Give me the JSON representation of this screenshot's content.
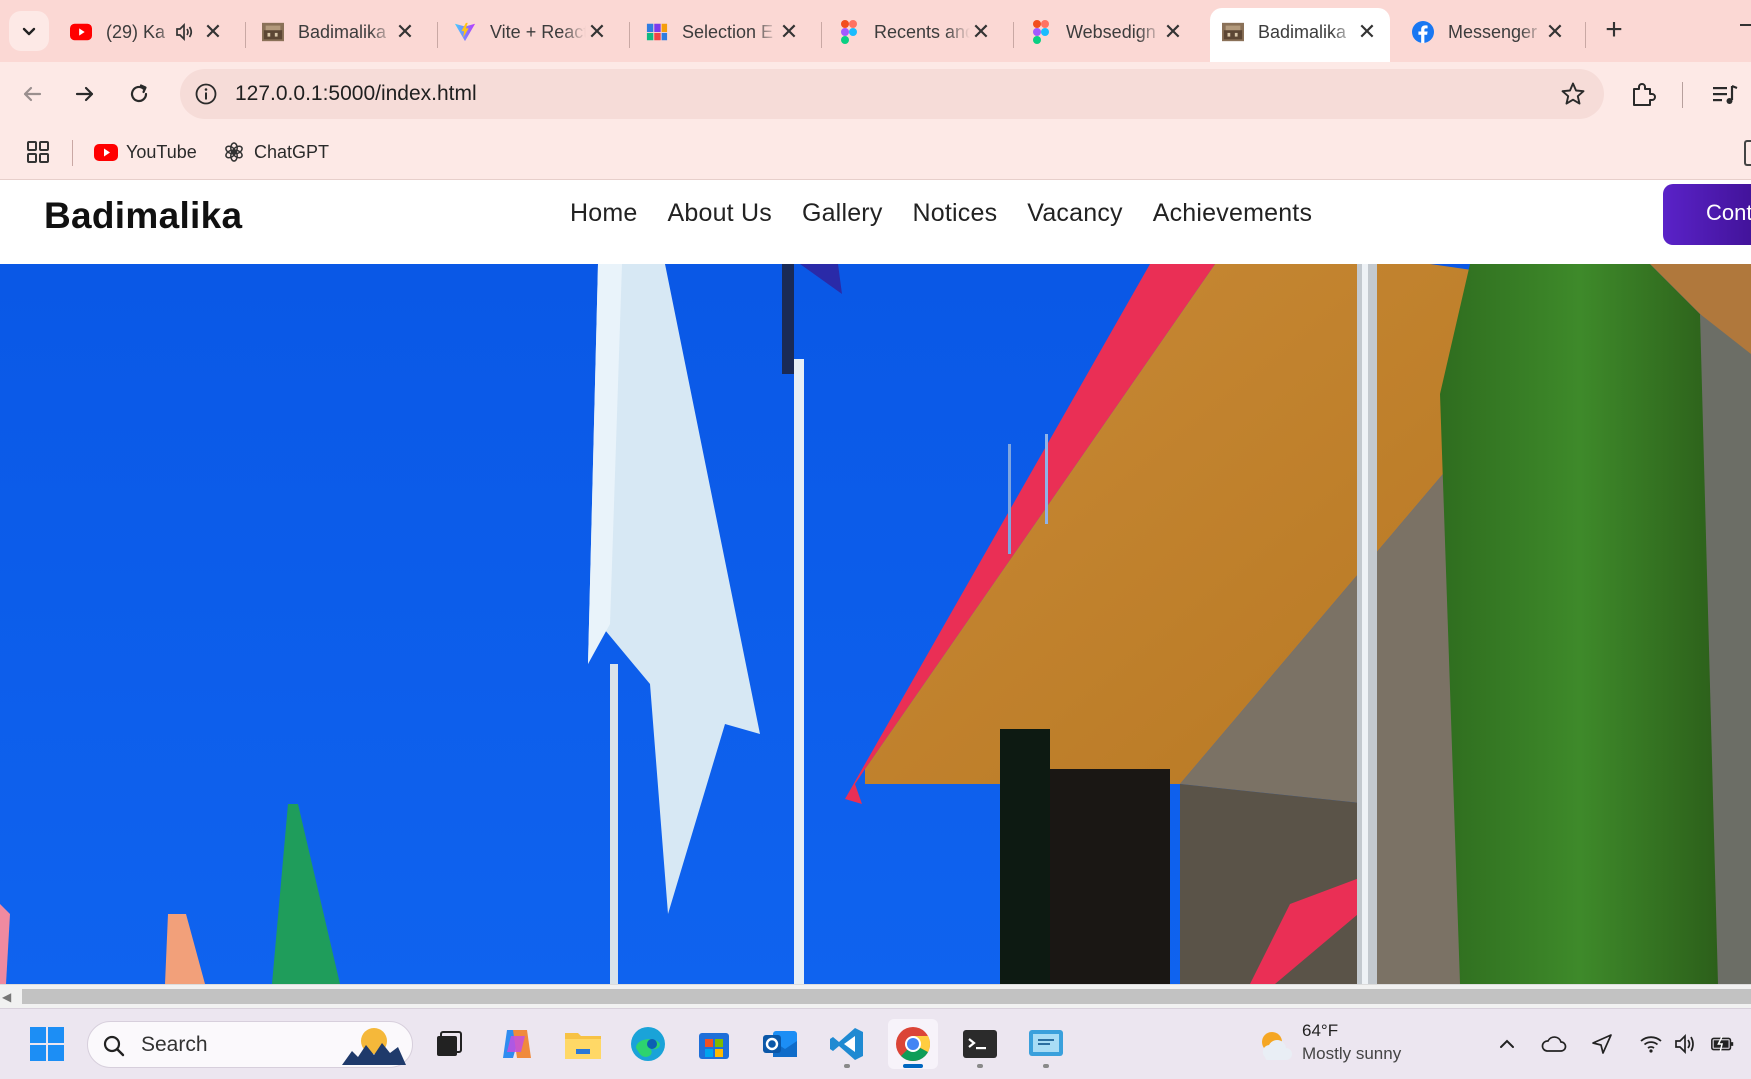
{
  "browser": {
    "tabs": [
      {
        "title": "(29) Ka",
        "favicon": "youtube-icon",
        "audio": true,
        "active": false
      },
      {
        "title": "Badimalika",
        "favicon": "school-photo-icon",
        "audio": false,
        "active": false
      },
      {
        "title": "Vite + React",
        "favicon": "vite-icon",
        "audio": false,
        "active": false
      },
      {
        "title": "Selection E",
        "favicon": "selection-app-icon",
        "audio": false,
        "active": false
      },
      {
        "title": "Recents and",
        "favicon": "figma-icon",
        "audio": false,
        "active": false
      },
      {
        "title": "Websedign",
        "favicon": "figma-icon",
        "audio": false,
        "active": false
      },
      {
        "title": "Badimalika",
        "favicon": "school-photo-icon",
        "audio": false,
        "active": true
      },
      {
        "title": "Messenger",
        "favicon": "facebook-icon",
        "audio": false,
        "active": false
      }
    ],
    "url": "127.0.0.1:5000/index.html",
    "bookmarks": [
      {
        "label": "YouTube",
        "icon": "youtube-icon"
      },
      {
        "label": "ChatGPT",
        "icon": "chatgpt-icon"
      }
    ]
  },
  "site": {
    "brand": "Badimalika",
    "menu": [
      "Home",
      "About Us",
      "Gallery",
      "Notices",
      "Vacancy",
      "Achievements"
    ],
    "contact_label": "Contact",
    "accent": "#4b18ad",
    "hero": "school-building-with-flags-photo"
  },
  "taskbar": {
    "search_label": "Search",
    "apps": [
      "start-icon",
      "search-icon",
      "task-view-icon",
      "copilot-icon",
      "file-explorer-icon",
      "edge-icon",
      "store-icon",
      "outlook-icon",
      "vscode-icon",
      "chrome-icon",
      "terminal-icon",
      "snipping-icon"
    ],
    "weather": {
      "temp": "64°F",
      "desc": "Mostly sunny"
    }
  }
}
